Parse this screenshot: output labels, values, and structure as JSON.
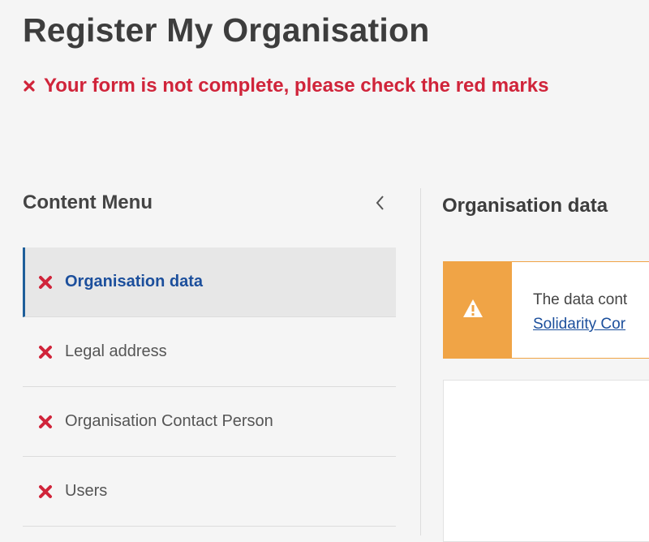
{
  "page": {
    "title": "Register My Organisation",
    "error_message": "Your form is not complete, please check the red marks"
  },
  "sidebar": {
    "title": "Content Menu",
    "collapse_icon": "chevron-left-icon",
    "items": [
      {
        "label": "Organisation data",
        "status": "error",
        "active": true
      },
      {
        "label": "Legal address",
        "status": "error",
        "active": false
      },
      {
        "label": "Organisation Contact Person",
        "status": "error",
        "active": false
      },
      {
        "label": "Users",
        "status": "error",
        "active": false
      }
    ]
  },
  "main": {
    "section_title": "Organisation data",
    "warning": {
      "icon": "warning-icon",
      "text": "The data cont",
      "link_text": "Solidarity Cor"
    }
  },
  "colors": {
    "error": "#d0243a",
    "active_text": "#1c4f9c",
    "warning": "#f0a446"
  }
}
